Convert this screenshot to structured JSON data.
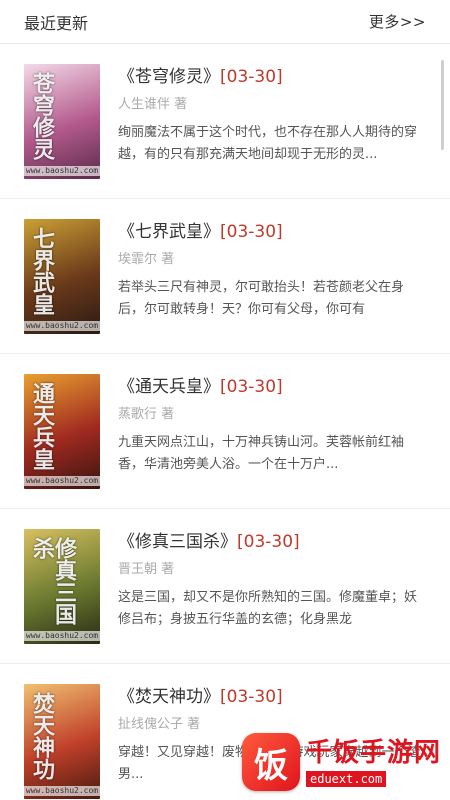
{
  "header": {
    "title": "最近更新",
    "more_label": "更多>>"
  },
  "books": [
    {
      "title": "《苍穹修灵》",
      "date": "[03-30]",
      "author": "人生谁伴 著",
      "desc": "绚丽魔法不属于这个时代，也不存在那人人期待的穿越，有的只有那充满天地间却现于无形的灵...",
      "cover_text": "www.baoshu2.com",
      "cover_glyphs": "苍穹修灵",
      "cover_colors": [
        "#f3d9e7",
        "#b35a8c",
        "#5a2b4a"
      ]
    },
    {
      "title": "《七界武皇》",
      "date": "[03-30]",
      "author": "埃霏尔 著",
      "desc": "若举头三尺有神灵，尔可敢抬头！若苍颜老父在身后，尔可敢转身！天？你可有父母，你可有",
      "cover_text": "www.baoshu2.com",
      "cover_glyphs": "七界武皇",
      "cover_colors": [
        "#caa035",
        "#6b3a1a",
        "#2a1a14"
      ]
    },
    {
      "title": "《通天兵皇》",
      "date": "[03-30]",
      "author": "蒸歌行 著",
      "desc": "九重天网点江山，十万神兵铸山河。芙蓉帐前红袖香，华清池旁美人浴。一个在十万户...",
      "cover_text": "www.baoshu2.com",
      "cover_glyphs": "通天兵皇",
      "cover_colors": [
        "#e8a030",
        "#a02a20",
        "#3a1410"
      ]
    },
    {
      "title": "《修真三国杀》",
      "date": "[03-30]",
      "author": "晋王朝 著",
      "desc": "这是三国，却又不是你所熟知的三国。修魔董卓；妖修吕布；身披五行华盖的玄德；化身黑龙",
      "cover_text": "www.baoshu2.com",
      "cover_glyphs": "修真三国杀",
      "cover_colors": [
        "#d8c060",
        "#6a7a30",
        "#2a2a14"
      ]
    },
    {
      "title": "《焚天神功》",
      "date": "[03-30]",
      "author": "扯线傀公子 著",
      "desc": "穿越！又见穿越！废物... 一个游戏玩家穿越到一个渣男...",
      "cover_text": "www.baoshu2.com",
      "cover_glyphs": "焚天神功",
      "cover_colors": [
        "#f0c070",
        "#c0402a",
        "#4a1a10"
      ]
    }
  ],
  "watermark": {
    "logo_glyph": "饭",
    "name": "千饭手游网",
    "url": "eduext.com"
  }
}
